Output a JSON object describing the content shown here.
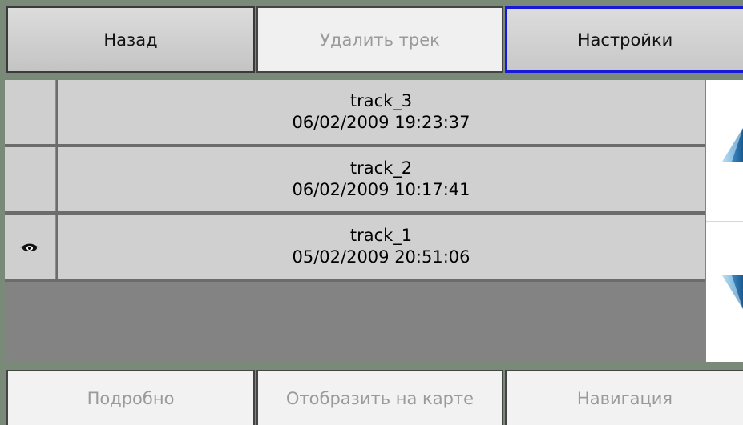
{
  "toolbar": {
    "back_label": "Назад",
    "delete_label": "Удалить трек",
    "settings_label": "Настройки"
  },
  "tracks": [
    {
      "name": "track_3",
      "datetime": "06/02/2009 19:23:37",
      "visible": false
    },
    {
      "name": "track_2",
      "datetime": "06/02/2009 10:17:41",
      "visible": false
    },
    {
      "name": "track_1",
      "datetime": "05/02/2009 20:51:06",
      "visible": true
    }
  ],
  "scroll": {
    "up_icon": "triangle-up-icon",
    "down_icon": "triangle-down-icon"
  },
  "bottom_toolbar": {
    "details_label": "Подробно",
    "show_on_map_label": "Отобразить на карте",
    "navigation_label": "Навигация"
  },
  "colors": {
    "background": "#7a8a79",
    "selected_border": "#1818d8",
    "disabled_text": "#9a9a9a",
    "arrow": "#2a6fa8"
  }
}
